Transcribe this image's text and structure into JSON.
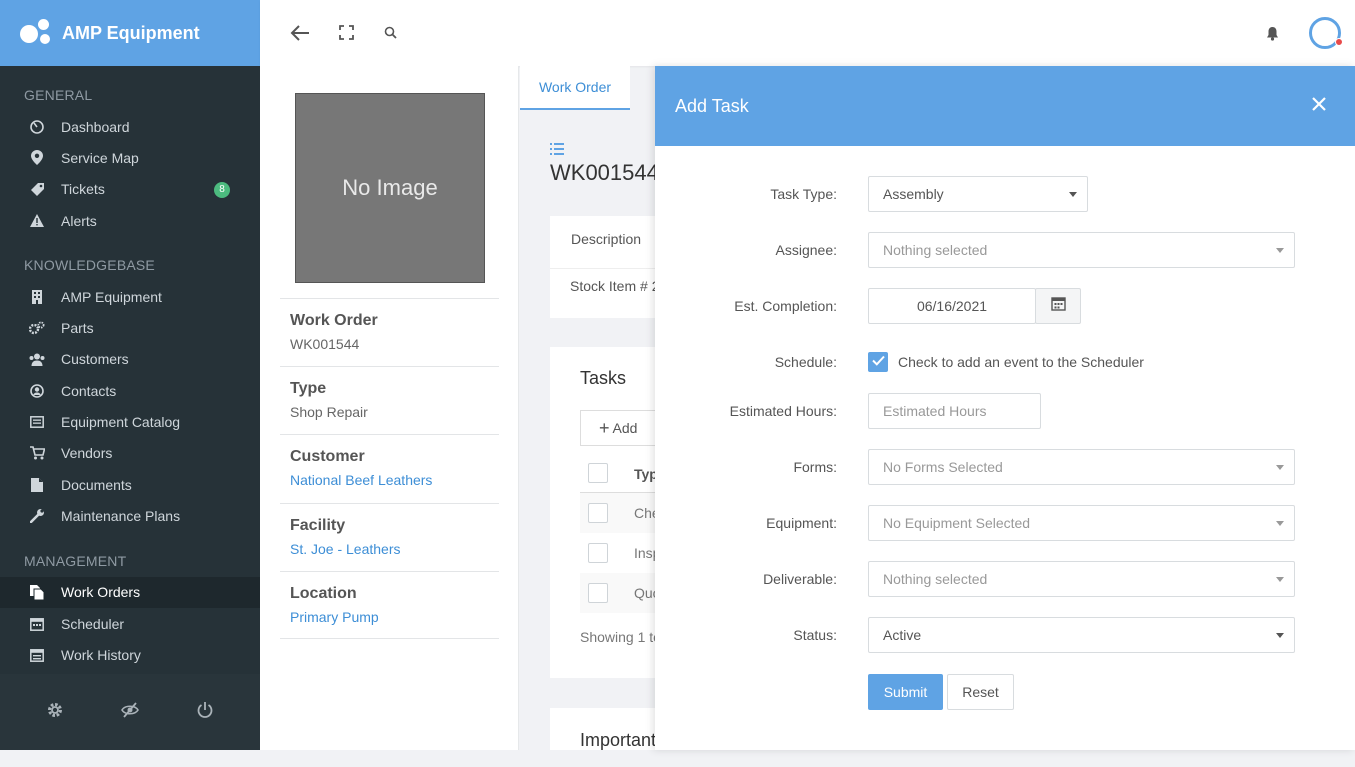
{
  "app": {
    "name": "AMP Equipment"
  },
  "sidebar": {
    "sections": [
      {
        "title": "GENERAL",
        "items": [
          {
            "label": "Dashboard",
            "icon": "dashboard-icon"
          },
          {
            "label": "Service Map",
            "icon": "map-pin-icon"
          },
          {
            "label": "Tickets",
            "icon": "ticket-icon",
            "badge": "8"
          },
          {
            "label": "Alerts",
            "icon": "alert-icon"
          }
        ]
      },
      {
        "title": "KNOWLEDGEBASE",
        "items": [
          {
            "label": "AMP Equipment",
            "icon": "building-icon"
          },
          {
            "label": "Parts",
            "icon": "gears-icon"
          },
          {
            "label": "Customers",
            "icon": "users-icon"
          },
          {
            "label": "Contacts",
            "icon": "contact-icon"
          },
          {
            "label": "Equipment Catalog",
            "icon": "catalog-icon"
          },
          {
            "label": "Vendors",
            "icon": "cart-icon"
          },
          {
            "label": "Documents",
            "icon": "document-icon"
          },
          {
            "label": "Maintenance Plans",
            "icon": "wrench-icon"
          }
        ]
      },
      {
        "title": "MANAGEMENT",
        "items": [
          {
            "label": "Work Orders",
            "icon": "work-orders-icon",
            "active": true
          },
          {
            "label": "Scheduler",
            "icon": "calendar-icon"
          },
          {
            "label": "Work History",
            "icon": "history-icon"
          }
        ]
      }
    ]
  },
  "detail": {
    "image_text": "No Image",
    "work_order": {
      "label": "Work Order",
      "value": "WK001544"
    },
    "type": {
      "label": "Type",
      "value": "Shop Repair"
    },
    "customer": {
      "label": "Customer",
      "value": "National Beef Leathers"
    },
    "facility": {
      "label": "Facility",
      "value": "St. Joe - Leathers"
    },
    "location": {
      "label": "Location",
      "value": "Primary Pump"
    }
  },
  "main": {
    "tab": "Work Order",
    "title": "WK001544",
    "description_label": "Description",
    "stock_item": "Stock Item # 2",
    "tasks_title": "Tasks",
    "add_label": "Add",
    "col_type": "Typ",
    "rows": [
      "Che",
      "Insp",
      "Quo"
    ],
    "showing": "Showing 1 to",
    "important": "Important"
  },
  "modal": {
    "title": "Add Task",
    "fields": {
      "task_type": {
        "label": "Task Type:",
        "value": "Assembly"
      },
      "assignee": {
        "label": "Assignee:",
        "placeholder": "Nothing selected"
      },
      "completion": {
        "label": "Est. Completion:",
        "value": "06/16/2021"
      },
      "schedule": {
        "label": "Schedule:",
        "checkbox_label": "Check to add an event to the Scheduler",
        "checked": true
      },
      "hours": {
        "label": "Estimated Hours:",
        "placeholder": "Estimated Hours"
      },
      "forms": {
        "label": "Forms:",
        "placeholder": "No Forms Selected"
      },
      "equipment": {
        "label": "Equipment:",
        "placeholder": "No Equipment Selected"
      },
      "deliverable": {
        "label": "Deliverable:",
        "placeholder": "Nothing selected"
      },
      "status": {
        "label": "Status:",
        "value": "Active"
      }
    },
    "submit": "Submit",
    "reset": "Reset"
  },
  "colors": {
    "brand": "#5fa3e4",
    "sidebar": "#263238",
    "badge": "#4cbb7f",
    "link": "#3d8ed6"
  }
}
